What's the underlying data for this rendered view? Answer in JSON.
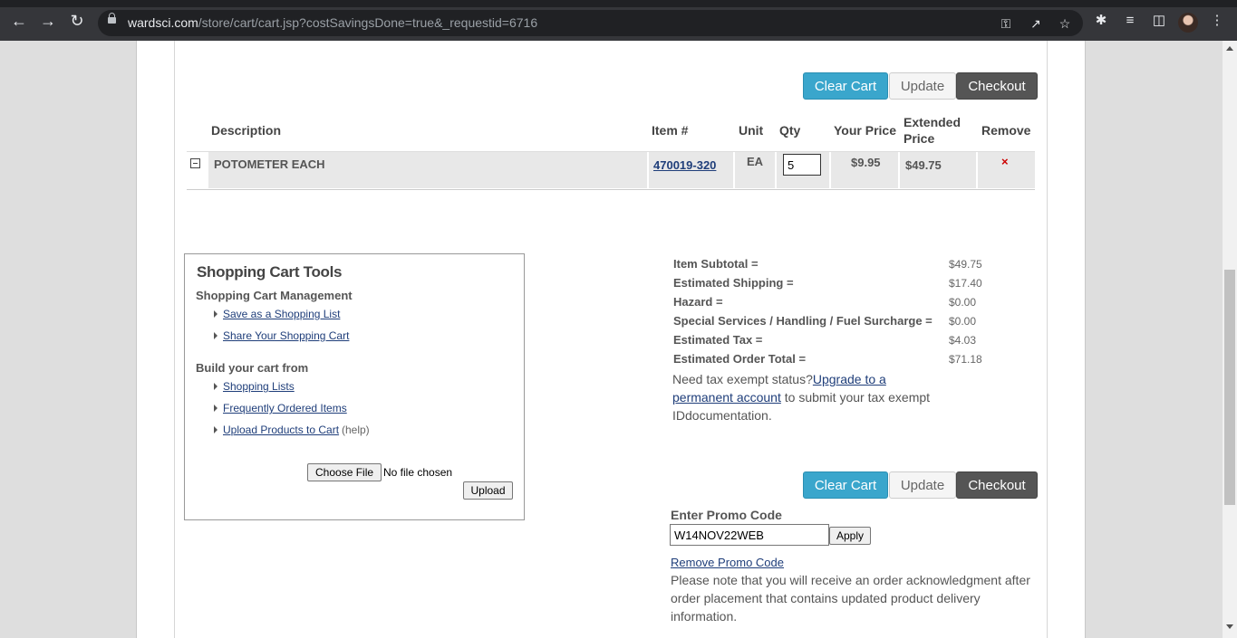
{
  "browser": {
    "url_host": "wardsci.com",
    "url_path": "/store/cart/cart.jsp?costSavingsDone=true&_requestid=6716"
  },
  "cart_buttons": {
    "clear": "Clear Cart",
    "update": "Update",
    "checkout": "Checkout"
  },
  "table": {
    "headers": {
      "description": "Description",
      "item": "Item #",
      "unit": "Unit",
      "qty": "Qty",
      "your_price": "Your Price",
      "extended_price_1": "Extended",
      "extended_price_2": "Price",
      "remove": "Remove"
    },
    "rows": [
      {
        "description": "POTOMETER EACH",
        "item": "470019-320",
        "unit": "EA",
        "qty": "5",
        "your_price": "$9.95",
        "extended_price": "$49.75",
        "remove": "×"
      }
    ]
  },
  "tools": {
    "title": "Shopping Cart Tools",
    "management_title": "Shopping Cart Management",
    "save_list": "Save as a Shopping List",
    "share_cart": "Share Your Shopping Cart",
    "build_title": "Build your cart from",
    "shopping_lists": "Shopping Lists",
    "frequent_items": "Frequently Ordered Items",
    "upload_products": "Upload Products to Cart",
    "help": "(help)",
    "choose_file": "Choose File",
    "no_file": "No file chosen",
    "upload": "Upload"
  },
  "totals": [
    {
      "label": "Item Subtotal =",
      "value": "$49.75"
    },
    {
      "label": "Estimated Shipping =",
      "value": "$17.40"
    },
    {
      "label": "Hazard =",
      "value": "$0.00"
    },
    {
      "label": "Special Services / Handling / Fuel Surcharge =",
      "value": "$0.00"
    },
    {
      "label": "Estimated Tax =",
      "value": "$4.03"
    },
    {
      "label": "Estimated Order Total =",
      "value": "$71.18"
    }
  ],
  "tax_note": {
    "prefix": "Need tax exempt status?",
    "link": "Upgrade to a permanent account",
    "suffix": " to submit your tax exempt IDdocumentation."
  },
  "promo": {
    "label": "Enter Promo Code",
    "value": "W14NOV22WEB",
    "apply": "Apply",
    "remove": "Remove Promo Code",
    "note": "Please note that you will receive an order acknowledgment after order placement that contains updated product delivery information."
  }
}
